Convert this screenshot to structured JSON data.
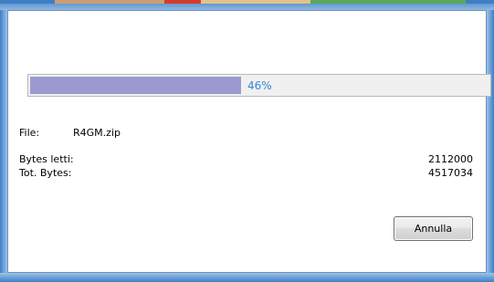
{
  "progress": {
    "percent": 46,
    "label": "46%"
  },
  "file": {
    "label": "File:",
    "name": "R4GM.zip"
  },
  "bytes_read": {
    "label": "Bytes letti:",
    "value": "2112000"
  },
  "total_bytes": {
    "label": "Tot. Bytes:",
    "value": "4517034"
  },
  "buttons": {
    "cancel_label": "Annulla"
  },
  "colors": {
    "progress_fill": "#9b9ad0",
    "progress_text": "#3e84d6",
    "frame": "#3f7ec4"
  }
}
